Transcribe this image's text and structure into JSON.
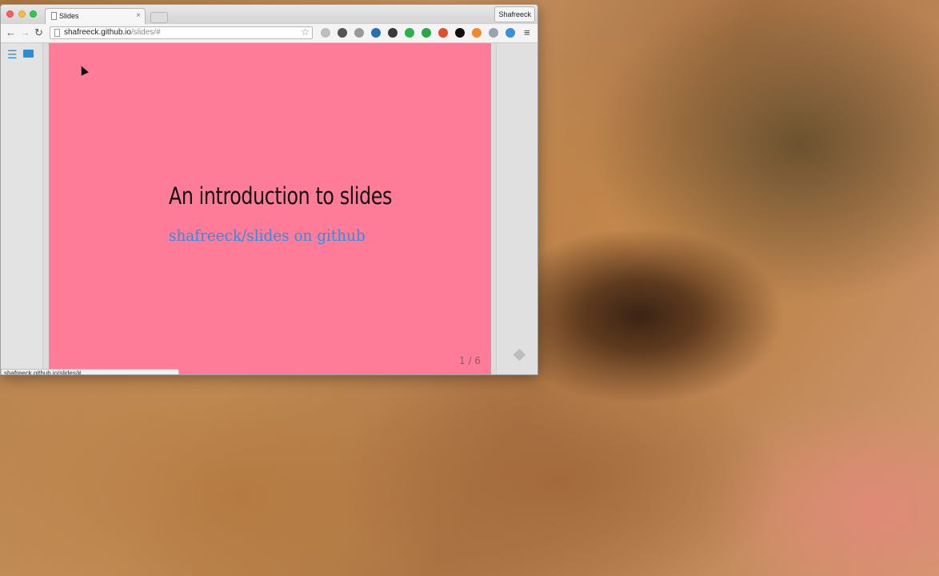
{
  "browser": {
    "tab_title": "Slides",
    "tab_close": "×",
    "profile_name": "Shafreeck",
    "url_host": "shafreeck.github.io",
    "url_path": "/slides/#",
    "nav_back": "←",
    "nav_forward": "→",
    "nav_reload": "↻",
    "bookmark_star": "☆",
    "menu": "≡",
    "status_url": "shafreeck.github.io/slides/#"
  },
  "extensions": [
    {
      "name": "ext-icon-1",
      "color": "#bdbdbd"
    },
    {
      "name": "ext-icon-2",
      "color": "#555555"
    },
    {
      "name": "ext-icon-3",
      "color": "#9a9a9a"
    },
    {
      "name": "ext-icon-4",
      "color": "#2a6fb0"
    },
    {
      "name": "ext-icon-5",
      "color": "#3a3a3a"
    },
    {
      "name": "ext-icon-6",
      "color": "#2bb24c"
    },
    {
      "name": "ext-icon-7",
      "color": "#28a745"
    },
    {
      "name": "ext-icon-8",
      "color": "#e0502a"
    },
    {
      "name": "ext-icon-9",
      "color": "#111111"
    },
    {
      "name": "ext-icon-10",
      "color": "#f28a2a"
    },
    {
      "name": "ext-icon-11",
      "color": "#9aa3ab"
    },
    {
      "name": "ext-icon-12",
      "color": "#3a8fd8"
    }
  ],
  "slide": {
    "title": "An introduction to slides",
    "link": "shafreeck/slides on github",
    "counter": "1 / 6",
    "background": "#ff7c98",
    "link_color": "#2a8fe8"
  },
  "sidebar": {
    "menu_icon": "☰"
  }
}
